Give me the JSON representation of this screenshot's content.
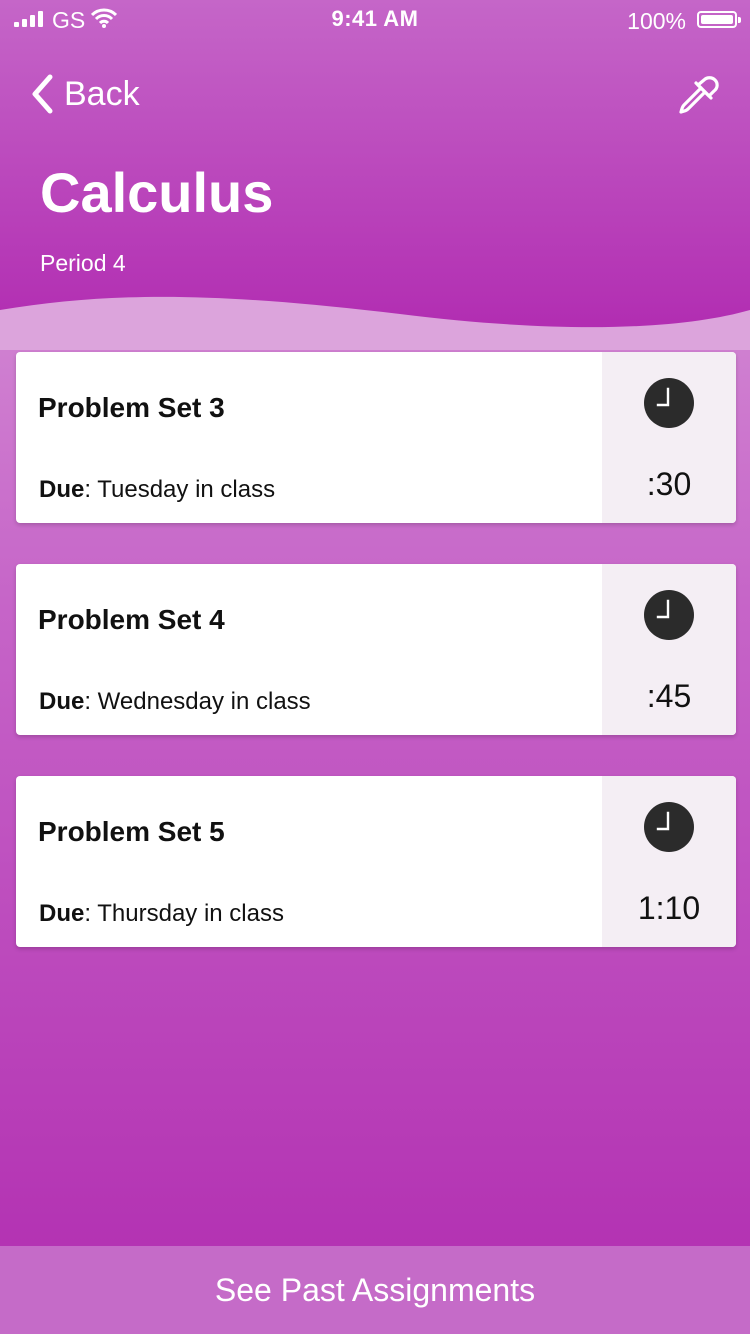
{
  "status_bar": {
    "carrier": "GS",
    "time": "9:41 AM",
    "battery": "100%"
  },
  "nav": {
    "back_label": "Back",
    "back_icon": "chevron-left-icon",
    "action_icon": "eyedropper-icon"
  },
  "header": {
    "title": "Calculus",
    "subtitle": "Period 4"
  },
  "assignments": [
    {
      "title": "Problem Set 3",
      "due_label": "Due",
      "due_value": ": Tuesday in class",
      "duration": ":30"
    },
    {
      "title": "Problem Set 4",
      "due_label": "Due",
      "due_value": ": Wednesday in class",
      "duration": ":45"
    },
    {
      "title": "Problem Set 5",
      "due_label": "Due",
      "due_value": ": Thursday in class",
      "duration": "1:10"
    }
  ],
  "footer": {
    "button_label": "See Past Assignments"
  },
  "colors": {
    "accent": "#b12bb1",
    "card_side": "#f4eef4"
  }
}
